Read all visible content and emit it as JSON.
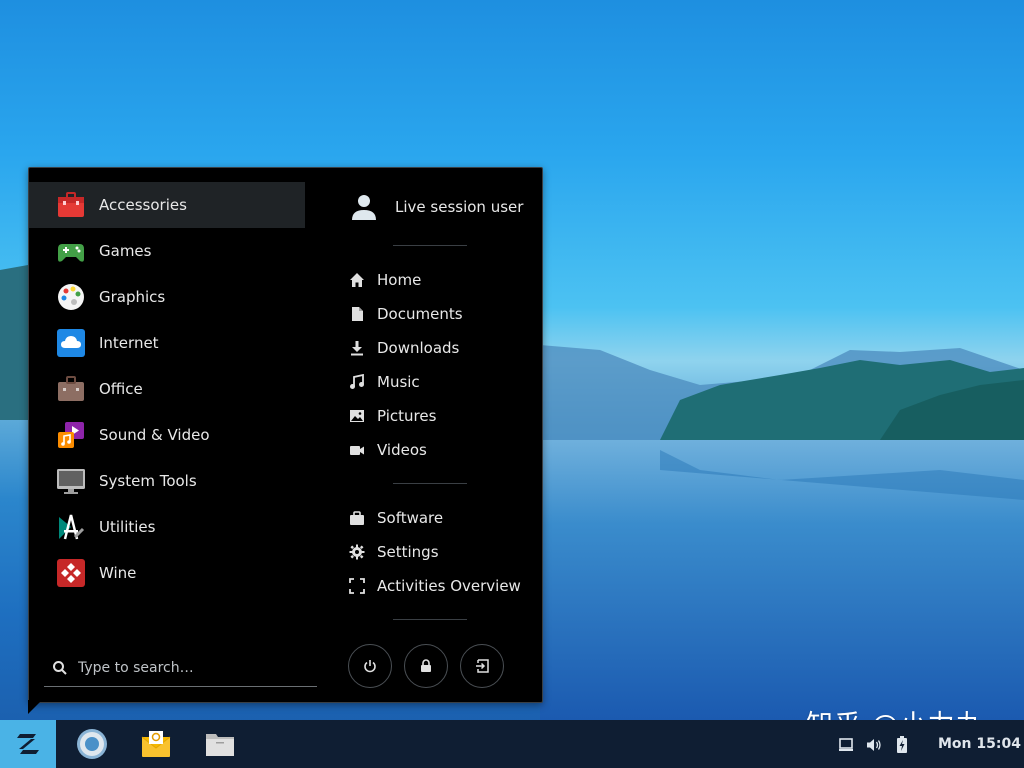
{
  "menu": {
    "categories": [
      {
        "label": "Accessories",
        "icon": "toolbox-icon",
        "color": "#e53935"
      },
      {
        "label": "Games",
        "icon": "gamepad-icon",
        "color": "#43a047"
      },
      {
        "label": "Graphics",
        "icon": "palette-icon",
        "color": "#f5f5f5"
      },
      {
        "label": "Internet",
        "icon": "cloud-icon",
        "color": "#1e88e5"
      },
      {
        "label": "Office",
        "icon": "briefcase-icon",
        "color": "#8d6e63"
      },
      {
        "label": "Sound & Video",
        "icon": "media-icon",
        "color": "#8e24aa"
      },
      {
        "label": "System Tools",
        "icon": "monitor-icon",
        "color": "#9e9e9e"
      },
      {
        "label": "Utilities",
        "icon": "utilities-icon",
        "color": "#424242"
      },
      {
        "label": "Wine",
        "icon": "wine-icon",
        "color": "#c62828"
      }
    ],
    "active_category": "Accessories",
    "search": {
      "placeholder": "Type to search…",
      "value": ""
    },
    "user": {
      "label": "Live session user"
    },
    "places": [
      {
        "label": "Home",
        "icon": "home-icon"
      },
      {
        "label": "Documents",
        "icon": "document-icon"
      },
      {
        "label": "Downloads",
        "icon": "download-icon"
      },
      {
        "label": "Music",
        "icon": "music-icon"
      },
      {
        "label": "Pictures",
        "icon": "picture-icon"
      },
      {
        "label": "Videos",
        "icon": "video-icon"
      }
    ],
    "system": [
      {
        "label": "Software",
        "icon": "software-icon"
      },
      {
        "label": "Settings",
        "icon": "gear-icon"
      },
      {
        "label": "Activities Overview",
        "icon": "overview-icon"
      }
    ],
    "actions": [
      "power-icon",
      "lock-icon",
      "logout-icon"
    ]
  },
  "taskbar": {
    "apps": [
      "chromium-icon",
      "mail-icon",
      "files-icon"
    ],
    "tray": [
      "screen-icon",
      "volume-icon",
      "battery-icon"
    ],
    "clock": "Mon 15:04",
    "accent": "#4ab3e6"
  },
  "watermark": "知乎 @小力丸"
}
